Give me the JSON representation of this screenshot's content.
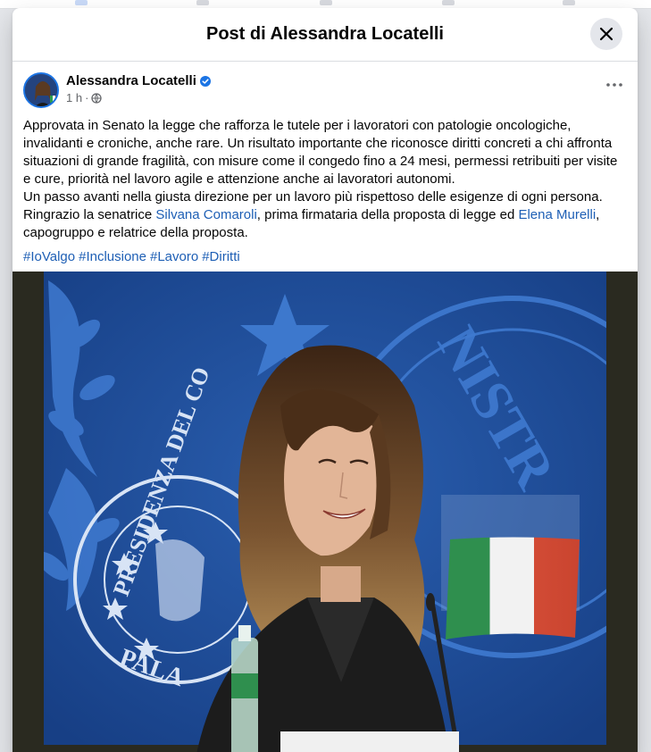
{
  "window": {
    "title": "Post di Alessandra Locatelli"
  },
  "post": {
    "author": "Alessandra Locatelli",
    "verified": true,
    "time": "1 h",
    "privacy_icon": "globe-icon",
    "text": {
      "p1": "Approvata in Senato la legge che rafforza le tutele per i lavoratori con patologie oncologiche, invalidanti e croniche, anche rare. Un risultato importante che riconosce diritti concreti a chi affronta situazioni di grande fragilità, con misure come il congedo fino a 24 mesi, permessi retribuiti per visite e cure, priorità nel lavoro agile e attenzione anche ai lavoratori autonomi.",
      "p2": "Un passo avanti nella giusta direzione per un lavoro più rispettoso delle esigenze di ogni persona.",
      "p3_a": "Ringrazio la senatrice ",
      "mention_1": "Silvana Comaroli",
      "p3_b": ", prima firmataria della proposta di legge ed ",
      "mention_2": "Elena Murelli",
      "p3_c": ", capogruppo e relatrice della proposta."
    },
    "hashtags": [
      "#IoValgo",
      "#Inclusione",
      "#Lavoro",
      "#Diritti"
    ],
    "photo": {
      "seal_text": "PRESIDENZA DEL CO",
      "seal_text_2": "PALA",
      "seal_text_3": "NISTR"
    }
  },
  "colors": {
    "accent": "#1b74e4",
    "link": "#1e5fb5",
    "backdrop_blue": "#1d4f9c"
  }
}
